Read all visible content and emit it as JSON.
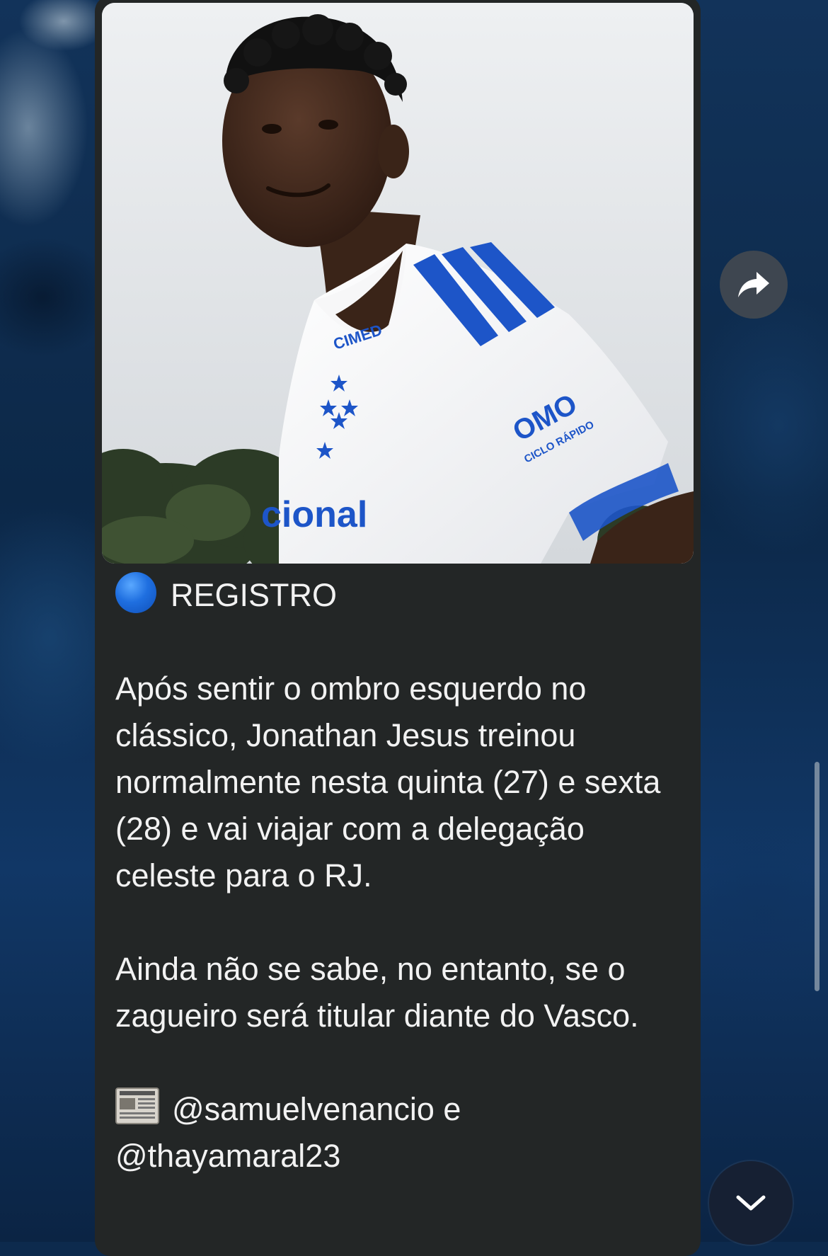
{
  "message": {
    "photo_alt": "",
    "tag_text": "REGISTRO",
    "paragraphs": [
      "Após sentir o ombro esquerdo no clássico, Jonathan Jesus treinou normalmente nesta quinta (27) e sexta (28) e vai viajar com a delegação celeste para o RJ.",
      "Ainda não se sabe, no entanto, se o zagueiro será titular diante do Vasco."
    ],
    "credits_line1": "@samuelvenancio e",
    "credits_line2": "@thayamaral23",
    "jersey": {
      "sponsor_chest": "CIMED",
      "sponsor_sleeve": "OMO",
      "sponsor_sleeve_sub": "CICLO RÁPIDO",
      "front_text": "cional"
    }
  },
  "icons": {
    "tag_marker": "blue-circle-icon",
    "credits_marker": "newspaper-icon",
    "share": "share-arrow-icon",
    "scroll_down": "chevron-down-icon"
  },
  "colors": {
    "bubble": "#232626",
    "text": "#f2f2f2",
    "accent_blue": "#1f6fe0"
  }
}
